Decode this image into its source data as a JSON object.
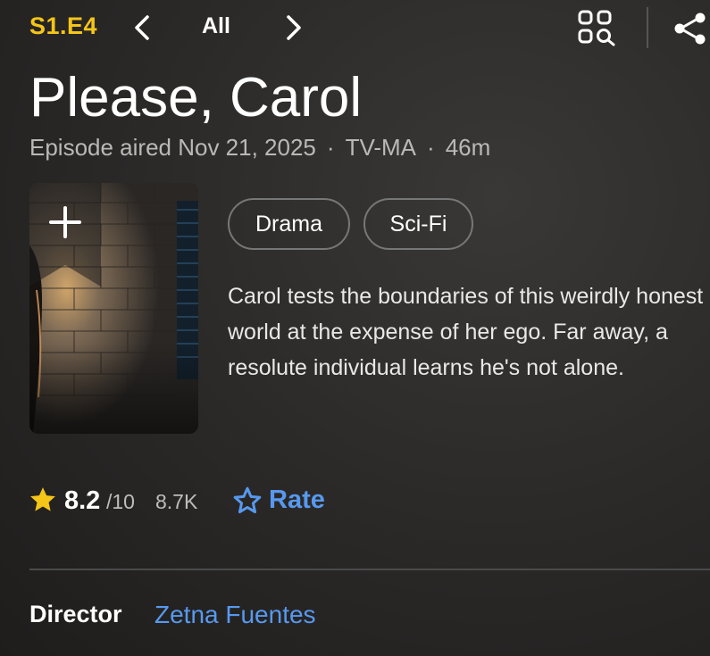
{
  "header": {
    "episode_code": "S1.E4",
    "nav_all_label": "All"
  },
  "episode": {
    "title": "Please, Carol",
    "aired": "Episode aired Nov 21, 2025",
    "rating_cert": "TV-MA",
    "runtime": "46m",
    "separator": "·"
  },
  "genres": [
    "Drama",
    "Sci-Fi"
  ],
  "plot": "Carol tests the boundaries of this weirdly honest world at the expense of her ego. Far away, a resolute individual learns he's not alone.",
  "rating": {
    "value": "8.2",
    "max": "/10",
    "count": "8.7K",
    "rate_label": "Rate"
  },
  "credits": {
    "director_label": "Director",
    "director_name": "Zetna Fuentes"
  },
  "colors": {
    "accent_yellow": "#f5c518",
    "link_blue": "#5799ef",
    "background": "#2a2827"
  },
  "icons": {
    "prev": "chevron-left-icon",
    "next": "chevron-right-icon",
    "grid_search": "grid-search-icon",
    "share": "share-icon",
    "add": "plus-icon",
    "star": "star-filled-icon",
    "rate": "star-outline-icon"
  }
}
